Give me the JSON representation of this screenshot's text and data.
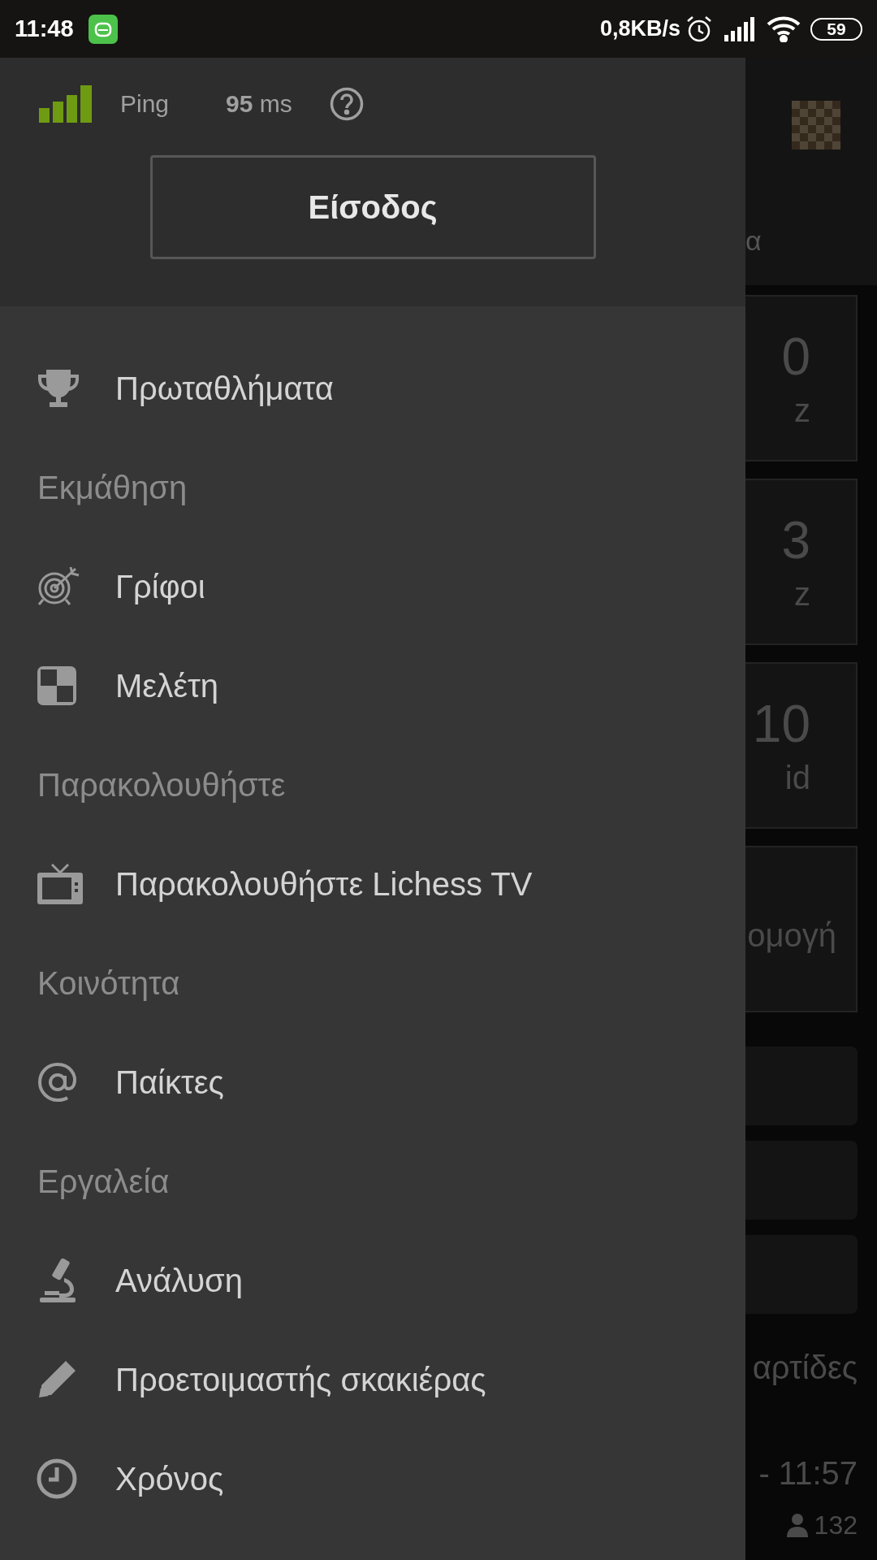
{
  "status_bar": {
    "time": "11:48",
    "data_rate": "0,8KB/s",
    "battery": "59"
  },
  "drawer": {
    "ping_label": "Ping",
    "ping_value": "**95** ms",
    "login_button": "Είσοδος",
    "entries": [
      {
        "kind": "item",
        "label": "Πρωταθλήματα"
      },
      {
        "kind": "section",
        "label": "Εκμάθηση"
      },
      {
        "kind": "item",
        "label": "Γρίφοι"
      },
      {
        "kind": "item",
        "label": "Μελέτη"
      },
      {
        "kind": "section",
        "label": "Παρακολουθήστε"
      },
      {
        "kind": "item",
        "label": "Παρακολουθήστε Lichess TV"
      },
      {
        "kind": "section",
        "label": "Κοινότητα"
      },
      {
        "kind": "item",
        "label": "Παίκτες"
      },
      {
        "kind": "section",
        "label": "Εργαλεία"
      },
      {
        "kind": "item",
        "label": "Ανάλυση"
      },
      {
        "kind": "item",
        "label": "Προετοιμαστής σκακιέρας"
      },
      {
        "kind": "item",
        "label": "Χρόνος"
      }
    ]
  },
  "background": {
    "header_text": "α",
    "cards": [
      {
        "value": "0",
        "label": "z"
      },
      {
        "value": "3",
        "label": "z"
      },
      {
        "value": "10",
        "label": "id"
      },
      {
        "label": "ομογή"
      }
    ],
    "section_title": "αρτίδες",
    "time": "- 11:57",
    "player_count": "132"
  }
}
